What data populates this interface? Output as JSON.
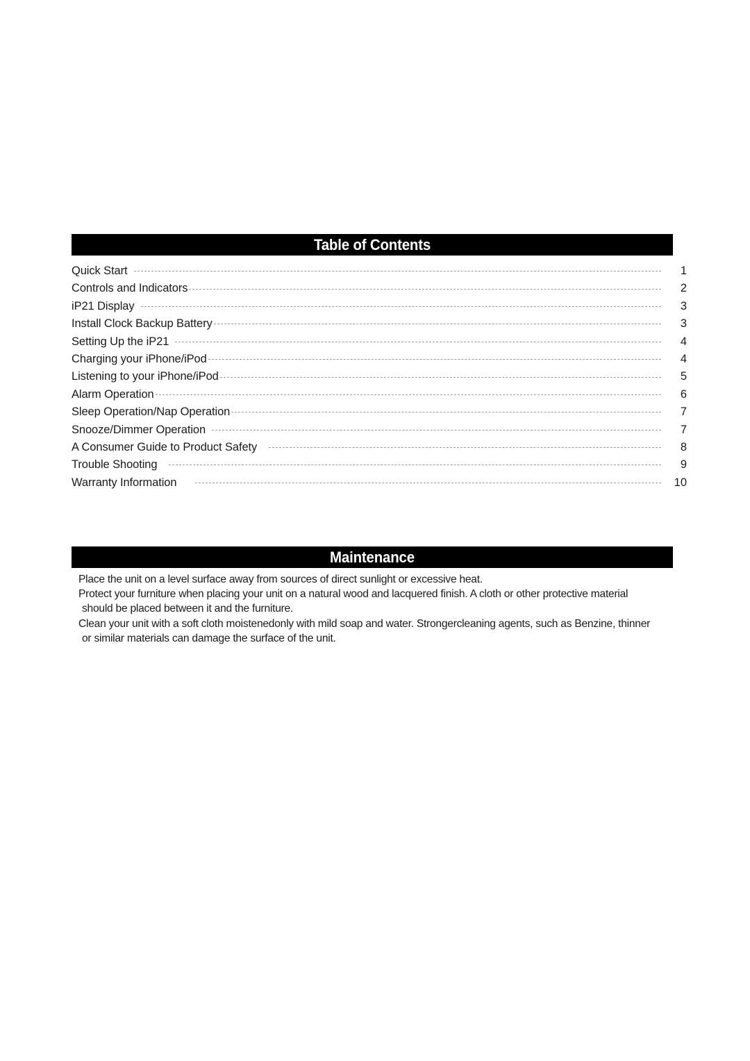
{
  "document": {
    "page_background": "#ffffff",
    "bar_color": "#000000",
    "bar_text_color": "#ffffff",
    "body_text_color": "#1a1a1a",
    "leader_color": "#9a9a9a"
  },
  "toc": {
    "heading": "Table of Contents",
    "entries": [
      {
        "label": "Quick Start",
        "page": "1",
        "gap": "gap-md"
      },
      {
        "label": "Controls and Indicators",
        "page": "2",
        "gap": "gap-sm"
      },
      {
        "label": "iP21 Display",
        "page": "3",
        "gap": "gap-md"
      },
      {
        "label": "Install Clock Backup Battery",
        "page": "3",
        "gap": "gap-sm"
      },
      {
        "label": "Setting Up the iP21",
        "page": "4",
        "gap": "gap-md"
      },
      {
        "label": "Charging your iPhone/iPod",
        "page": "4",
        "gap": "gap-sm"
      },
      {
        "label": "Listening to your iPhone/iPod",
        "page": "5",
        "gap": "gap-sm"
      },
      {
        "label": "Alarm Operation",
        "page": "6",
        "gap": "gap-sm"
      },
      {
        "label": "Sleep Operation/Nap Operation",
        "page": "7",
        "gap": "gap-sm"
      },
      {
        "label": "Snooze/Dimmer Operation",
        "page": "7",
        "gap": "gap-md"
      },
      {
        "label": "A Consumer Guide to Product Safety",
        "page": "8",
        "gap": "gap-lg"
      },
      {
        "label": "Trouble Shooting",
        "page": "9",
        "gap": "gap-lg"
      },
      {
        "label": "Warranty Information",
        "page": "10",
        "gap": "gap-xl"
      }
    ]
  },
  "maintenance": {
    "heading": "Maintenance",
    "paragraphs": [
      {
        "line1": "Place the unit on a level surface away from sources of direct sunlight or excessive heat.",
        "line2": "",
        "line3": ""
      },
      {
        "line1": "Protect your furniture when placing your unit on a natural wood and lacquered finish. A cloth or other protective material",
        "line2": "should be placed between it and the furniture.",
        "line3": ""
      },
      {
        "line1": "Clean your unit with a soft cloth moistenedonly with mild soap and water. Strongercleaning agents, such as Benzine, thinner",
        "line2": "or similar materials can damage the surface of the unit.",
        "line3": ""
      }
    ]
  }
}
